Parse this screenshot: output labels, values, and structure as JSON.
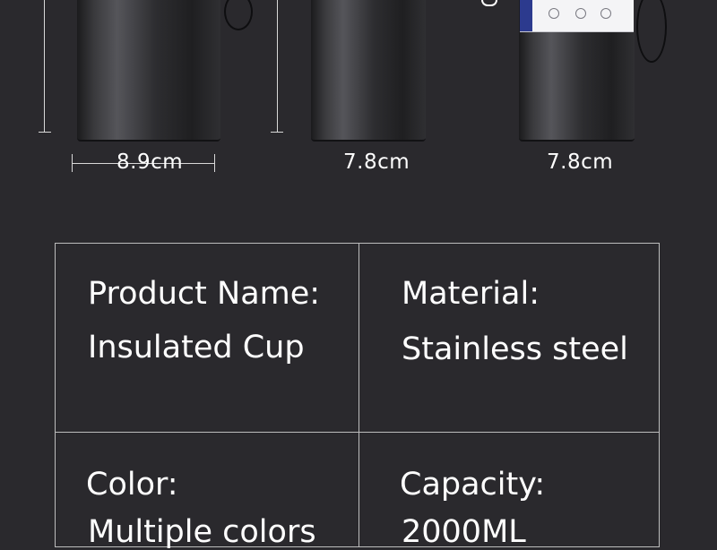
{
  "dimensions": {
    "width_1": "8.9cm",
    "width_2": "7.8cm",
    "width_3": "7.8cm"
  },
  "specs": {
    "product_name_label": "Product Name:",
    "product_name_value": "Insulated Cup",
    "material_label": "Material:",
    "material_value": "Stainless steel",
    "color_label": "Color:",
    "color_value": "Multiple colors",
    "capacity_label": "Capacity:",
    "capacity_value": "2000ML"
  },
  "colors": {
    "background": "#2a292d",
    "text": "#ffffff",
    "table_border": "#bdbdbd",
    "label_band": "#2c3a8e"
  }
}
